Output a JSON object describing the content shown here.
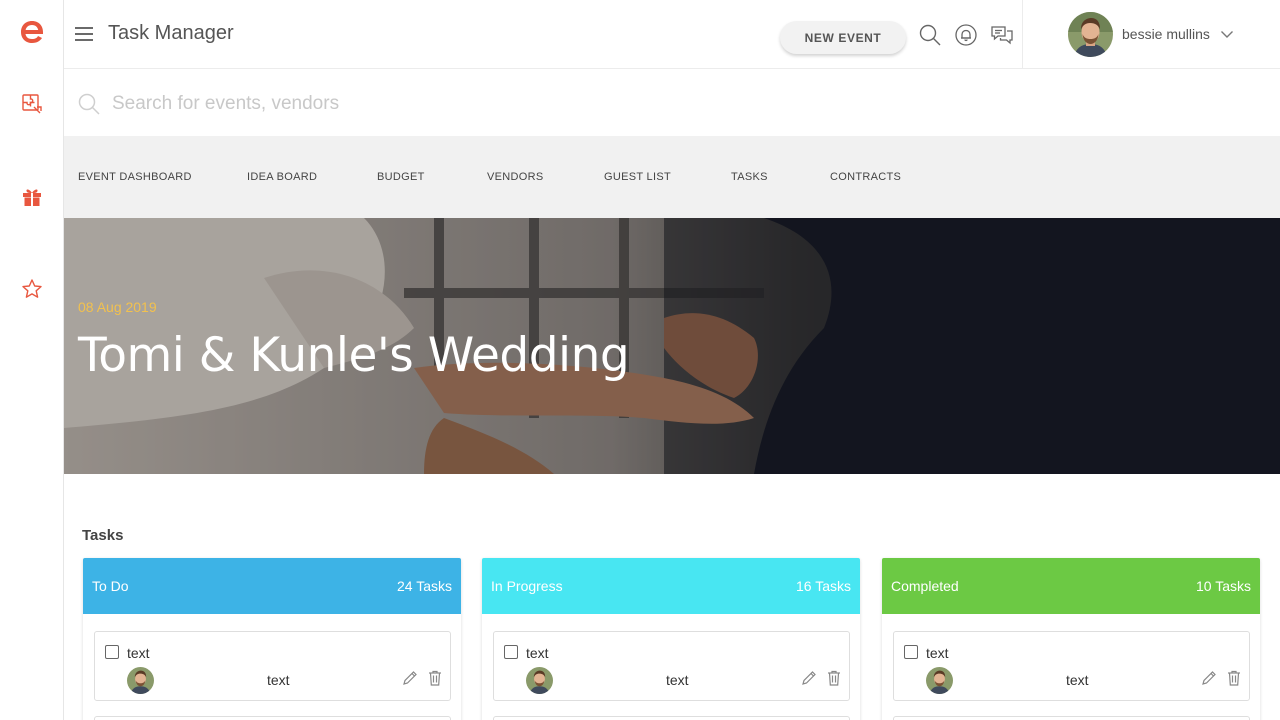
{
  "app": {
    "title": "Task Manager",
    "brand_color": "#e8573f"
  },
  "rail": {
    "items": [
      {
        "icon": "puzzle-icon"
      },
      {
        "icon": "gift-icon"
      },
      {
        "icon": "star-icon"
      }
    ]
  },
  "toolbar": {
    "new_event_label": "NEW EVENT",
    "icons": [
      "search-icon",
      "bell-icon",
      "chat-icon"
    ]
  },
  "user": {
    "name": "bessie mullins"
  },
  "search": {
    "placeholder": "Search for events, vendors",
    "value": ""
  },
  "tabs": [
    {
      "label": "EVENT DASHBOARD"
    },
    {
      "label": "IDEA BOARD"
    },
    {
      "label": "BUDGET"
    },
    {
      "label": "VENDORS"
    },
    {
      "label": "GUEST LIST"
    },
    {
      "label": "TASKS"
    },
    {
      "label": "CONTRACTS"
    }
  ],
  "hero": {
    "date": "08 Aug 2019",
    "title": "Tomi & Kunle's Wedding"
  },
  "tasks": {
    "heading": "Tasks",
    "columns": [
      {
        "title": "To Do",
        "count": "24 Tasks",
        "color": "#3db3e6",
        "cards": [
          {
            "title": "text",
            "subtitle": "text",
            "checked": false
          }
        ]
      },
      {
        "title": "In Progress",
        "count": "16 Tasks",
        "color": "#48e6f2",
        "cards": [
          {
            "title": "text",
            "subtitle": "text",
            "checked": false
          }
        ]
      },
      {
        "title": "Completed",
        "count": "10 Tasks",
        "color": "#6cc944",
        "cards": [
          {
            "title": "text",
            "subtitle": "text",
            "checked": false
          }
        ]
      }
    ]
  }
}
